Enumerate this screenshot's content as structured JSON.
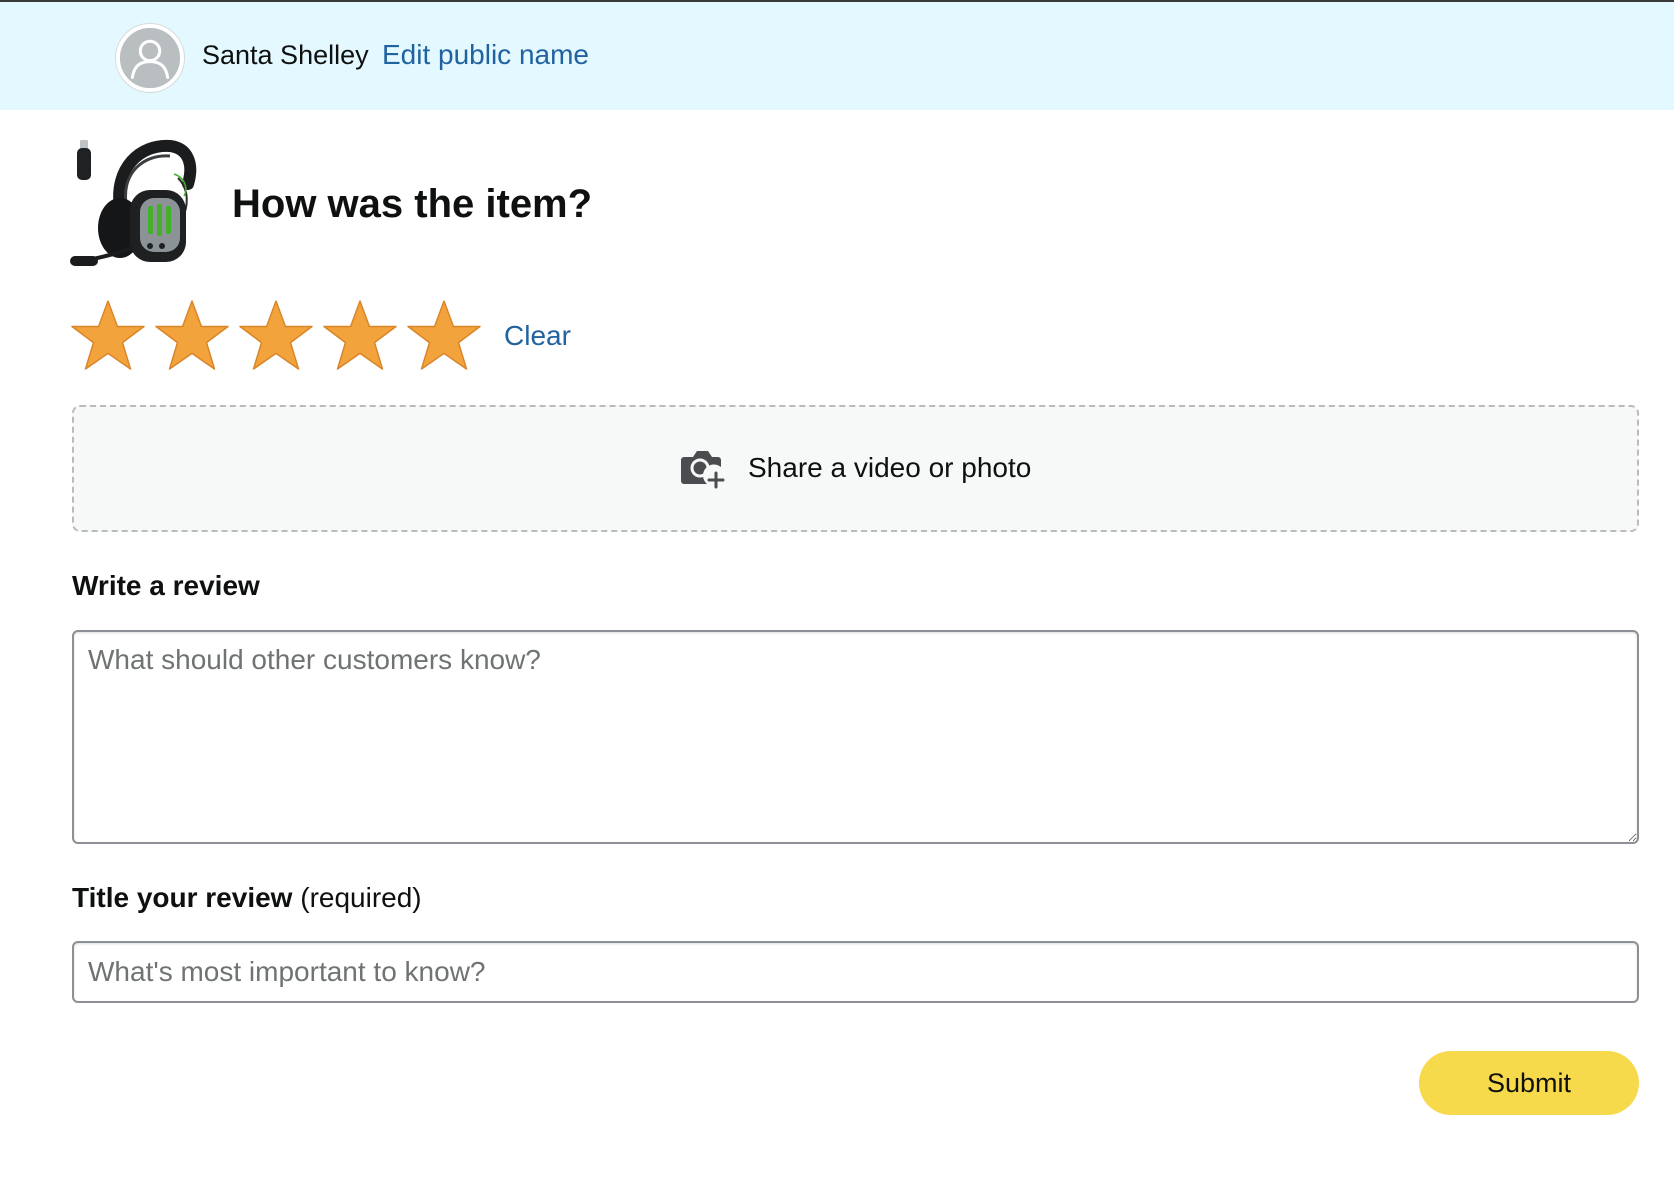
{
  "header": {
    "user_name": "Santa Shelley",
    "edit_link": "Edit public name",
    "background_color": "#e3f8ff"
  },
  "product": {
    "image_icon": "headset-icon",
    "heading": "How was the item?"
  },
  "rating": {
    "stars_total": 5,
    "stars_selected": 5,
    "star_color": "#f3a33b",
    "clear_label": "Clear"
  },
  "media_upload": {
    "icon": "camera-plus-icon",
    "label": "Share a video or photo"
  },
  "review": {
    "label": "Write a review",
    "placeholder": "What should other customers know?",
    "value": ""
  },
  "title": {
    "label_bold": "Title your review",
    "label_suffix": " (required)",
    "placeholder": "What's most important to know?",
    "value": ""
  },
  "submit": {
    "label": "Submit",
    "color": "#f7d94c"
  },
  "colors": {
    "link": "#2162a1",
    "text": "#0f1111"
  }
}
